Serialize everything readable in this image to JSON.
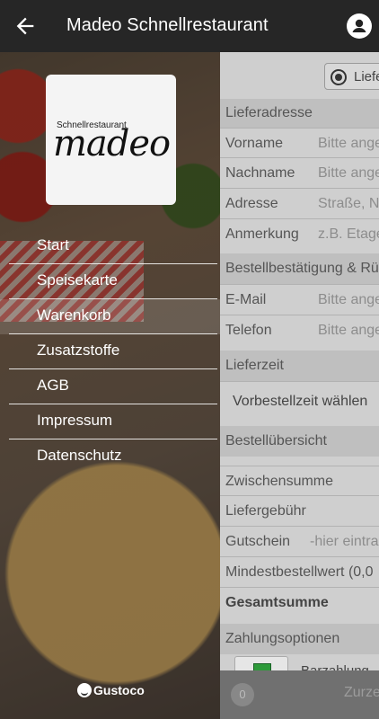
{
  "header": {
    "title": "Madeo Schnellrestaurant",
    "back_icon": "back-arrow-icon",
    "account_icon": "account-icon"
  },
  "drawer": {
    "logo_small": "Schnellrestaurant",
    "logo_big": "madeo",
    "items": [
      {
        "label": "Start"
      },
      {
        "label": "Speisekarte"
      },
      {
        "label": "Warenkorb"
      },
      {
        "label": "Zusatzstoffe"
      },
      {
        "label": "AGB"
      },
      {
        "label": "Impressum"
      },
      {
        "label": "Datenschutz"
      }
    ],
    "footer_brand": "Gustoco"
  },
  "order": {
    "delivery_option": "Liefe",
    "sections": {
      "address": "Lieferadresse",
      "confirmation": "Bestellbestätigung & Rü",
      "delivery_time": "Lieferzeit",
      "summary": "Bestellübersicht",
      "payment": "Zahlungsoptionen"
    },
    "fields": {
      "first_name": {
        "label": "Vorname",
        "placeholder": "Bitte ange"
      },
      "last_name": {
        "label": "Nachname",
        "placeholder": "Bitte ange"
      },
      "address": {
        "label": "Adresse",
        "placeholder": "Straße, N"
      },
      "note": {
        "label": "Anmerkung",
        "placeholder": "z.B. Etage"
      },
      "email": {
        "label": "E-Mail",
        "placeholder": "Bitte ange"
      },
      "phone": {
        "label": "Telefon",
        "placeholder": "Bitte ange"
      }
    },
    "preorder": "Vorbestellzeit wählen",
    "subtotal": "Zwischensumme",
    "delivery_fee": "Liefergebühr",
    "voucher": {
      "label": "Gutschein",
      "placeholder": "-hier eintra"
    },
    "min_order": "Mindestbestellwert (0,0",
    "total": "Gesamtsumme",
    "payment_method": "Barzahlung",
    "cart_count": "0",
    "bottom_action": "Zurze"
  }
}
